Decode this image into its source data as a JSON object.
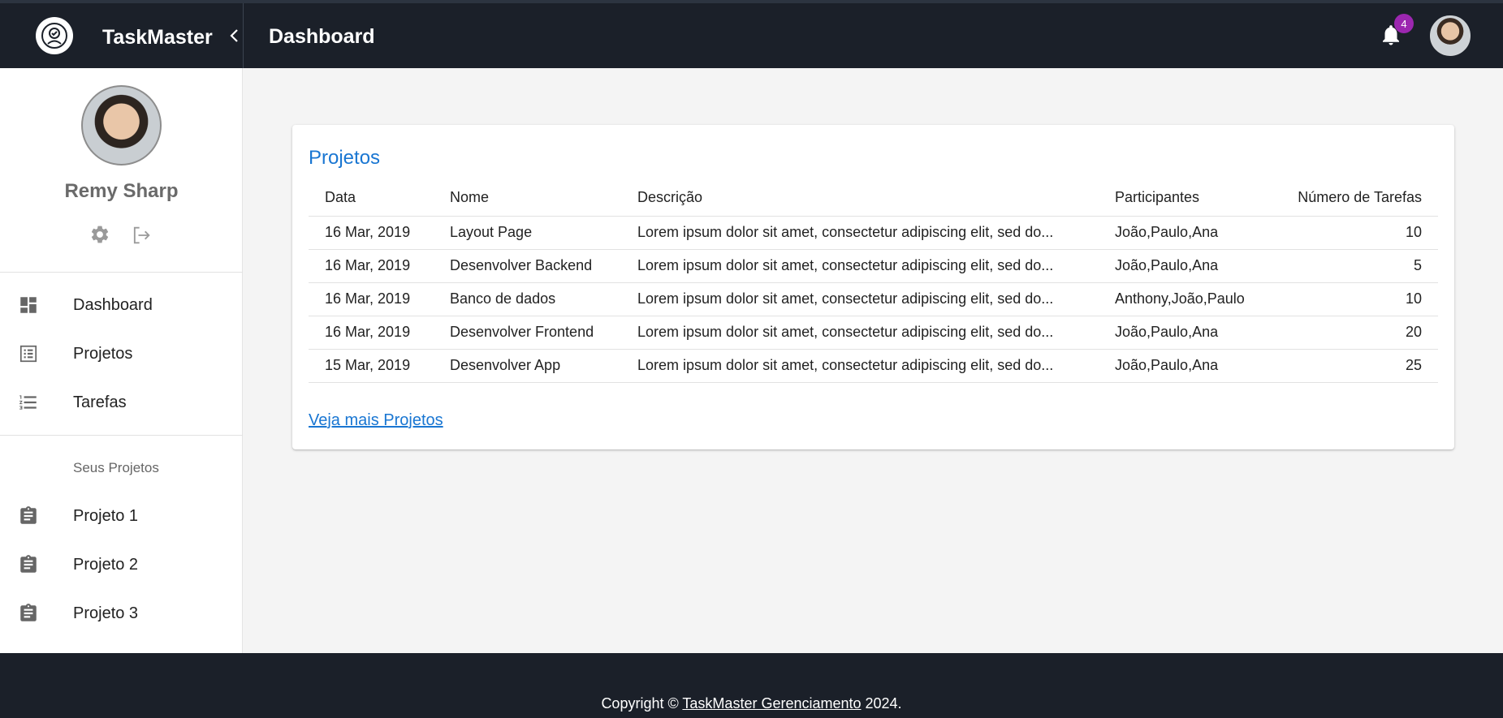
{
  "brand": {
    "title": "TaskMaster"
  },
  "header": {
    "title": "Dashboard",
    "notification_count": "4"
  },
  "profile": {
    "name": "Remy Sharp"
  },
  "nav": {
    "items": [
      {
        "label": "Dashboard",
        "icon": "dashboard-icon"
      },
      {
        "label": "Projetos",
        "icon": "list-alt-icon"
      },
      {
        "label": "Tarefas",
        "icon": "format-list-numbered-icon"
      }
    ],
    "section_label": "Seus Projetos",
    "projects": [
      {
        "label": "Projeto 1",
        "icon": "assignment-icon"
      },
      {
        "label": "Projeto 2",
        "icon": "assignment-icon"
      },
      {
        "label": "Projeto 3",
        "icon": "assignment-icon"
      }
    ]
  },
  "projects_card": {
    "title": "Projetos",
    "columns": [
      "Data",
      "Nome",
      "Descrição",
      "Participantes",
      "Número de Tarefas"
    ],
    "rows": [
      {
        "date": "16 Mar, 2019",
        "name": "Layout Page",
        "description": "Lorem ipsum dolor sit amet, consectetur adipiscing elit, sed do...",
        "participants": "João,Paulo,Ana",
        "tasks": "10"
      },
      {
        "date": "16 Mar, 2019",
        "name": "Desenvolver Backend",
        "description": "Lorem ipsum dolor sit amet, consectetur adipiscing elit, sed do...",
        "participants": "João,Paulo,Ana",
        "tasks": "5"
      },
      {
        "date": "16 Mar, 2019",
        "name": "Banco de dados",
        "description": "Lorem ipsum dolor sit amet, consectetur adipiscing elit, sed do...",
        "participants": "Anthony,João,Paulo",
        "tasks": "10"
      },
      {
        "date": "16 Mar, 2019",
        "name": "Desenvolver Frontend",
        "description": "Lorem ipsum dolor sit amet, consectetur adipiscing elit, sed do...",
        "participants": "João,Paulo,Ana",
        "tasks": "20"
      },
      {
        "date": "15 Mar, 2019",
        "name": "Desenvolver App",
        "description": "Lorem ipsum dolor sit amet, consectetur adipiscing elit, sed do...",
        "participants": "João,Paulo,Ana",
        "tasks": "25"
      }
    ],
    "more_link": "Veja mais Projetos"
  },
  "footer": {
    "prefix": "Copyright © ",
    "link": "TaskMaster Gerenciamento",
    "suffix": " 2024."
  },
  "colors": {
    "appbar": "#1b2029",
    "accent": "#1976d2",
    "badge": "#9c27b0"
  }
}
